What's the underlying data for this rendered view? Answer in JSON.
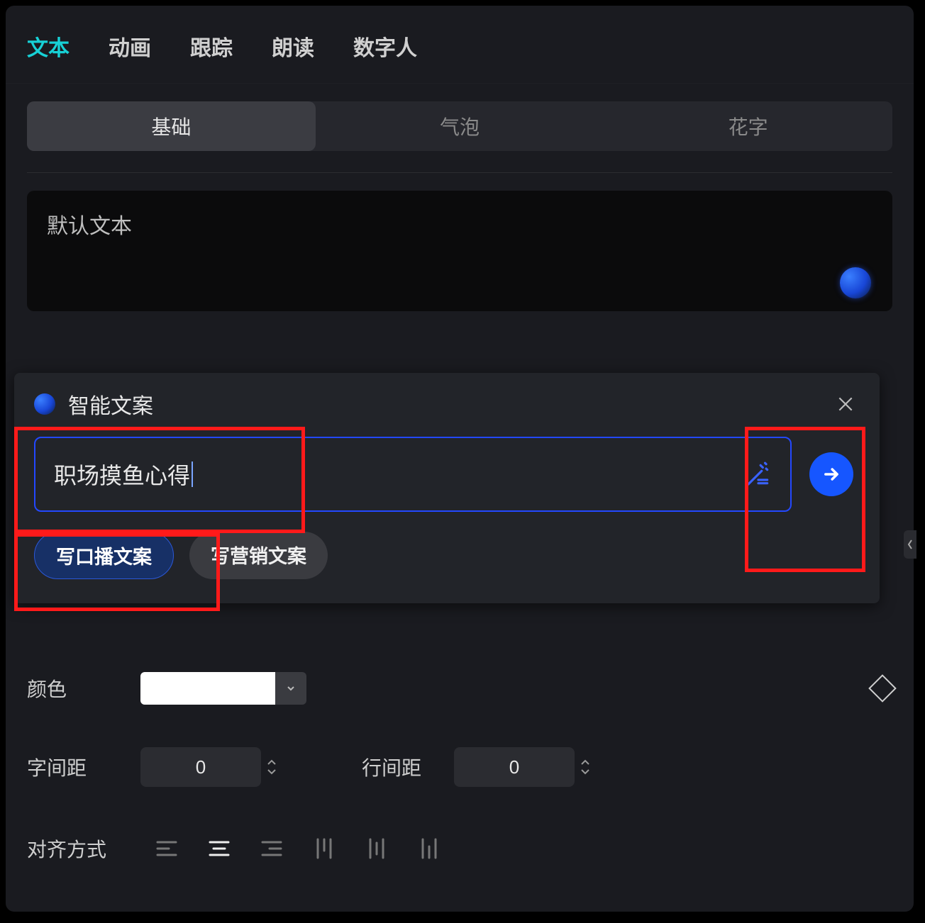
{
  "topTabs": {
    "text": "文本",
    "anim": "动画",
    "track": "跟踪",
    "read": "朗读",
    "avatar": "数字人"
  },
  "subTabs": {
    "basic": "基础",
    "bubble": "气泡",
    "fancy": "花字"
  },
  "textArea": {
    "value": "默认文本"
  },
  "popup": {
    "title": "智能文案",
    "input": "职场摸鱼心得",
    "chipPrimary": "写口播文案",
    "chipSecondary": "写营销文案"
  },
  "controls": {
    "colorLabel": "颜色",
    "colorValue": "#FFFFFF",
    "letterSpacingLabel": "字间距",
    "letterSpacingValue": "0",
    "lineSpacingLabel": "行间距",
    "lineSpacingValue": "0",
    "alignLabel": "对齐方式"
  }
}
